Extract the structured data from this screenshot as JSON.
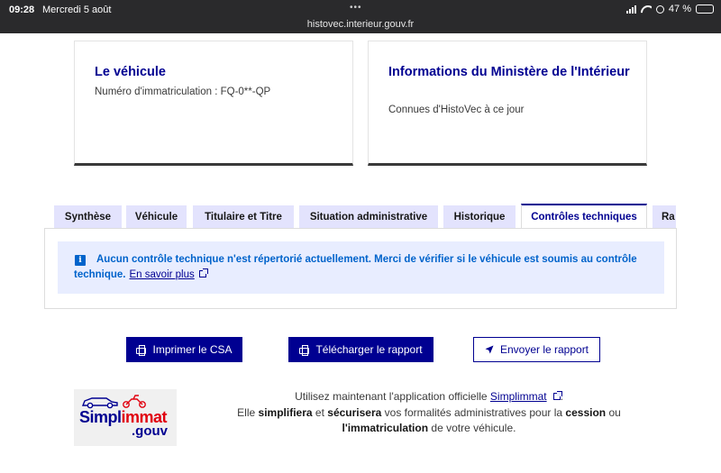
{
  "status_bar": {
    "time": "09:28",
    "date": "Mercredi 5 août",
    "url": "histovec.interieur.gouv.fr",
    "battery": "47 %",
    "battery_level": 0.47
  },
  "cards": {
    "vehicle": {
      "title": "Le véhicule",
      "text": "Numéro d'immatriculation : FQ-0**-QP"
    },
    "ministry": {
      "title": "Informations du Ministère de l'Intérieur",
      "text": "Connues d'HistoVec à ce jour"
    }
  },
  "tabs": [
    {
      "label": "Synthèse",
      "active": false
    },
    {
      "label": "Véhicule",
      "active": false
    },
    {
      "label": "Titulaire et Titre",
      "active": false
    },
    {
      "label": "Situation administrative",
      "active": false
    },
    {
      "label": "Historique",
      "active": false
    },
    {
      "label": "Contrôles techniques",
      "active": true
    },
    {
      "label": "Ra",
      "active": false
    }
  ],
  "notice": {
    "icon": "i",
    "text": "Aucun contrôle technique n'est répertorié actuellement. Merci de vérifier si le véhicule est soumis au contrôle technique.",
    "link": "En savoir plus"
  },
  "buttons": {
    "print_csa": "Imprimer le CSA",
    "download_report": "Télécharger le rapport",
    "send_report": "Envoyer le rapport"
  },
  "footer": {
    "logo_word_1": "Simpl",
    "logo_word_2": "immat",
    "logo_suffix": ".gouv",
    "line1_prefix": "Utilisez maintenant l'application officielle",
    "line1_link": "Simplimmat",
    "line1_suffix": ".",
    "line2_a": "Elle",
    "line2_b": "simplifiera",
    "line2_c": "et",
    "line2_d": "sécurisera",
    "line2_e": "vos formalités administratives pour la",
    "line2_f": "cession",
    "line2_g": "ou",
    "line3_a": "l'immatriculation",
    "line3_b": "de votre véhicule."
  },
  "colors": {
    "primary": "#000091",
    "info": "#0063cb",
    "tab_bg": "#e3e3fd",
    "notice_bg": "#e8edff",
    "logo_red": "#e1000f"
  }
}
